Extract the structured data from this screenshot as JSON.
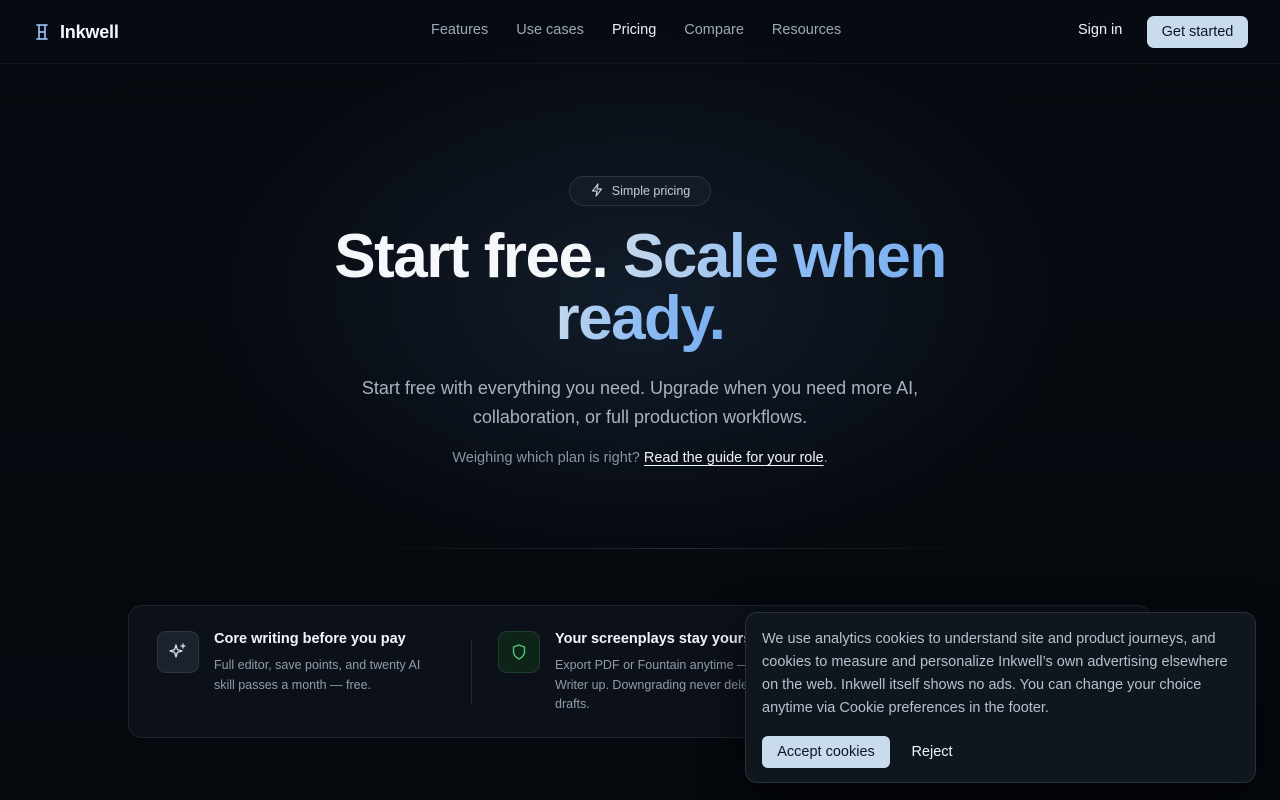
{
  "header": {
    "brand": "Inkwell",
    "nav": [
      "Features",
      "Use cases",
      "Pricing",
      "Compare",
      "Resources"
    ],
    "active_nav": "Pricing",
    "sign_in": "Sign in",
    "get_started": "Get started"
  },
  "hero": {
    "pill": "Simple pricing",
    "headline_plain": "Start free.",
    "headline_accent_1": "Scale when",
    "headline_accent_2": "ready.",
    "subtitle": "Start free with everything you need. Upgrade when you need more AI, collaboration, or full production workflows.",
    "guide_prefix": "Weighing which plan is right?",
    "guide_link": "Read the guide for your role",
    "guide_suffix": "."
  },
  "features": [
    {
      "icon": "sparkle-icon",
      "title": "Core writing before you pay",
      "desc": "Full editor, save points, and twenty AI skill passes a month — free."
    },
    {
      "icon": "shield-icon",
      "title": "Your screenplays stay yours",
      "desc": "Export PDF or Fountain anytime — from Writer up. Downgrading never deletes drafts."
    }
  ],
  "cookie": {
    "text": "We use analytics cookies to understand site and product journeys, and cookies to measure and personalize Inkwell’s own advertising elsewhere on the web. Inkwell itself shows no ads. You can change your choice anytime via Cookie preferences in the footer.",
    "accept": "Accept cookies",
    "reject": "Reject"
  },
  "colors": {
    "background": "#05080d",
    "accent": "#c9dcee",
    "headline_gradient_start": "#c4d8ec",
    "headline_gradient_end": "#7aaef0",
    "shield_green": "#4ec57a"
  }
}
